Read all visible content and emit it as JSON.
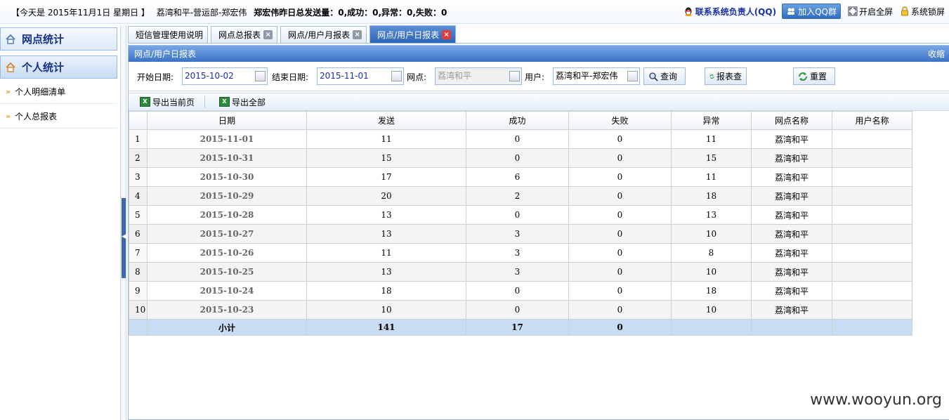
{
  "topbar": {
    "today": "【今天是 2015年11月1日 星期日 】",
    "user_path": "荔湾和平-营运部-郑宏伟",
    "summary": "郑宏伟昨日总发送量：0,成功：0,异常：0,失败：0",
    "contact": "联系系统负责人(QQ)",
    "qq_group": "加入QQ群",
    "fullscreen": "开启全屏",
    "lock": "系统锁屏"
  },
  "sidebar": {
    "sections": [
      {
        "label": "网点统计"
      },
      {
        "label": "个人统计"
      }
    ],
    "items": [
      {
        "label": "个人明细清单"
      },
      {
        "label": "个人总报表"
      }
    ]
  },
  "tabs": [
    {
      "label": "短信管理使用说明"
    },
    {
      "label": "网点总报表"
    },
    {
      "label": "网点/用户月报表"
    },
    {
      "label": "网点/用户日报表"
    }
  ],
  "panel": {
    "title": "网点/用户日报表",
    "collapse": "收缩"
  },
  "filters": {
    "start_label": "开始日期:",
    "start_value": "2015-10-02",
    "end_label": "结束日期:",
    "end_value": "2015-11-01",
    "site_label": "网点:",
    "site_value": "荔湾和平",
    "user_label": "用户:",
    "user_value": "荔湾和平-郑宏伟",
    "query_button": "查询",
    "report_button": "报表查",
    "reset_button": "重置"
  },
  "toolbar": {
    "export_page": "导出当前页",
    "export_all": "导出全部"
  },
  "grid": {
    "columns": [
      "日期",
      "发送",
      "成功",
      "失败",
      "异常",
      "网点名称",
      "用户名称"
    ],
    "rows": [
      {
        "n": "1",
        "date": "2015-11-01",
        "sent": "11",
        "ok": "0",
        "fail": "0",
        "err": "11",
        "site": "荔湾和平",
        "user": ""
      },
      {
        "n": "2",
        "date": "2015-10-31",
        "sent": "15",
        "ok": "0",
        "fail": "0",
        "err": "15",
        "site": "荔湾和平",
        "user": ""
      },
      {
        "n": "3",
        "date": "2015-10-30",
        "sent": "17",
        "ok": "6",
        "fail": "0",
        "err": "11",
        "site": "荔湾和平",
        "user": ""
      },
      {
        "n": "4",
        "date": "2015-10-29",
        "sent": "20",
        "ok": "2",
        "fail": "0",
        "err": "18",
        "site": "荔湾和平",
        "user": ""
      },
      {
        "n": "5",
        "date": "2015-10-28",
        "sent": "13",
        "ok": "0",
        "fail": "0",
        "err": "13",
        "site": "荔湾和平",
        "user": ""
      },
      {
        "n": "6",
        "date": "2015-10-27",
        "sent": "13",
        "ok": "3",
        "fail": "0",
        "err": "10",
        "site": "荔湾和平",
        "user": ""
      },
      {
        "n": "7",
        "date": "2015-10-26",
        "sent": "11",
        "ok": "3",
        "fail": "0",
        "err": "8",
        "site": "荔湾和平",
        "user": ""
      },
      {
        "n": "8",
        "date": "2015-10-25",
        "sent": "13",
        "ok": "3",
        "fail": "0",
        "err": "10",
        "site": "荔湾和平",
        "user": ""
      },
      {
        "n": "9",
        "date": "2015-10-24",
        "sent": "18",
        "ok": "0",
        "fail": "0",
        "err": "18",
        "site": "荔湾和平",
        "user": ""
      },
      {
        "n": "10",
        "date": "2015-10-23",
        "sent": "10",
        "ok": "0",
        "fail": "0",
        "err": "10",
        "site": "荔湾和平",
        "user": ""
      }
    ],
    "summary": {
      "label": "小计",
      "sent": "141",
      "ok": "17",
      "fail": "0"
    }
  },
  "watermark": "www.wooyun.org",
  "colors": {
    "accent": "#2c63b5",
    "header_border": "#99bbe8",
    "summary_row": "#c8dcf3",
    "close_active": "#e23b3b"
  }
}
